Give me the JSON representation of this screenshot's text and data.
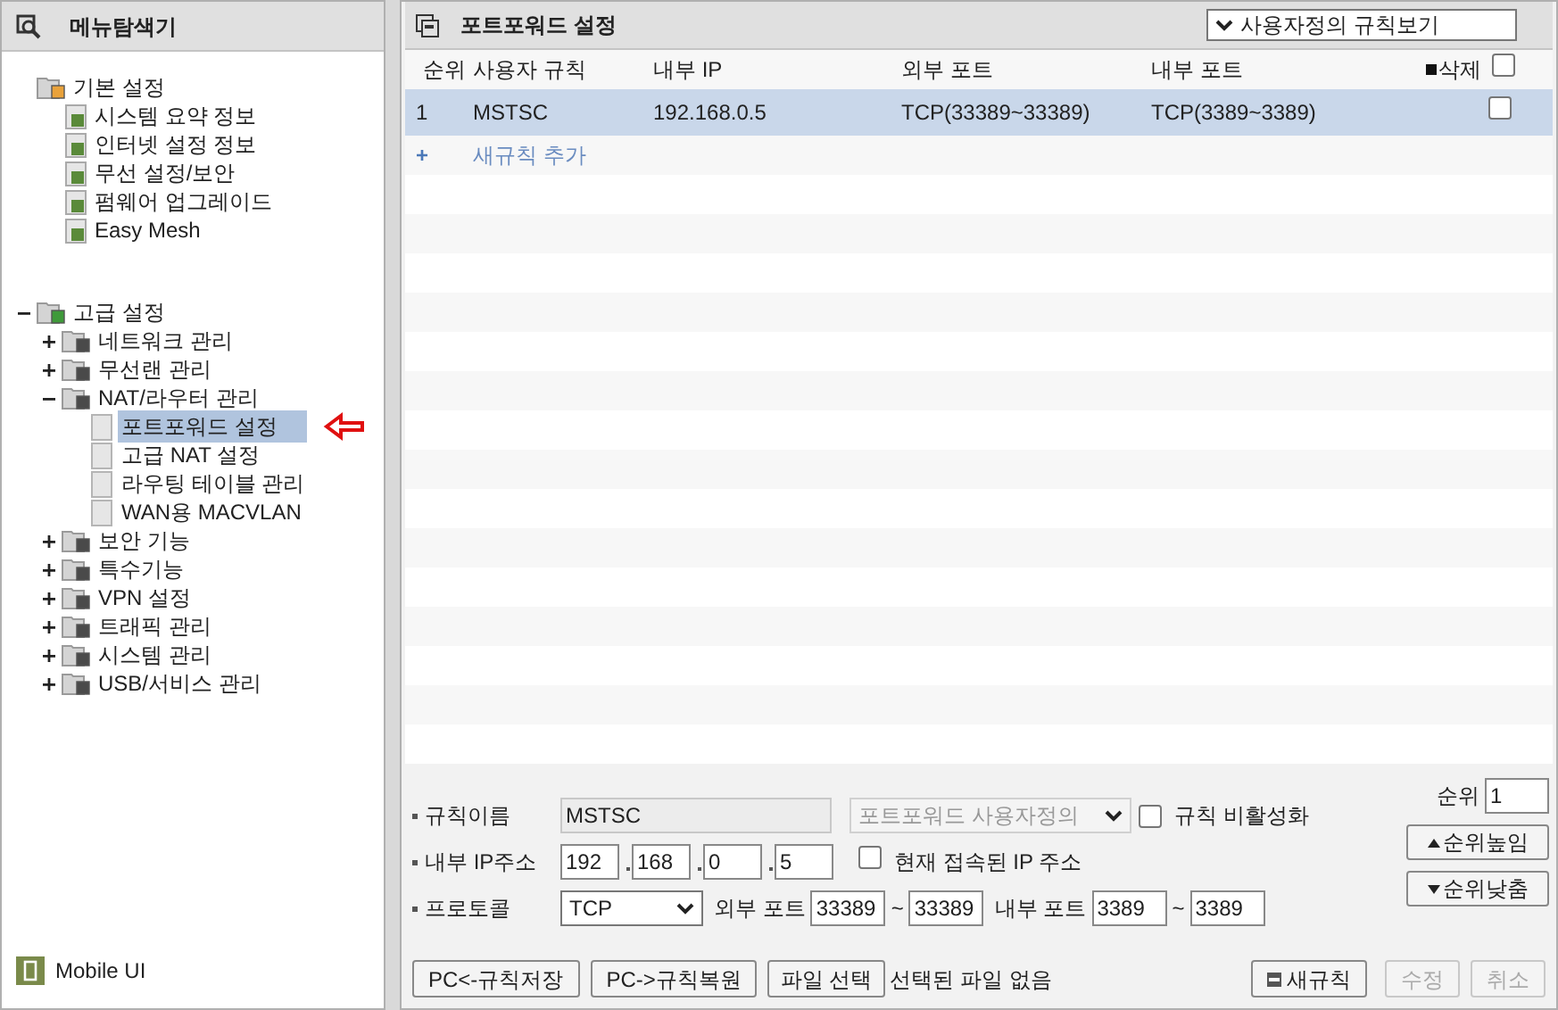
{
  "sidebar": {
    "title": "메뉴탐색기",
    "groups": [
      {
        "label": "기본 설정",
        "children": [
          {
            "label": "시스템 요약 정보",
            "selected": false
          },
          {
            "label": "인터넷 설정 정보",
            "selected": false
          },
          {
            "label": "무선 설정/보안",
            "selected": false
          },
          {
            "label": "펌웨어 업그레이드",
            "selected": false
          },
          {
            "label": "Easy Mesh",
            "selected": false
          }
        ]
      },
      {
        "label": "고급 설정",
        "expanded": true,
        "children": [
          {
            "label": "네트워크 관리",
            "expanded": false,
            "selected": false
          },
          {
            "label": "무선랜 관리",
            "expanded": false,
            "selected": false
          },
          {
            "label": "NAT/라우터 관리",
            "expanded": true,
            "selected": false,
            "children": [
              {
                "label": "포트포워드 설정",
                "selected": true
              },
              {
                "label": "고급 NAT 설정",
                "selected": false
              },
              {
                "label": "라우팅 테이블 관리",
                "selected": false
              },
              {
                "label": "WAN용 MACVLAN",
                "selected": false
              }
            ]
          },
          {
            "label": "보안 기능",
            "expanded": false,
            "selected": false
          },
          {
            "label": "특수기능",
            "expanded": false,
            "selected": false
          },
          {
            "label": "VPN 설정",
            "expanded": false,
            "selected": false
          },
          {
            "label": "트래픽 관리",
            "expanded": false,
            "selected": false
          },
          {
            "label": "시스템 관리",
            "expanded": false,
            "selected": false
          },
          {
            "label": "USB/서비스 관리",
            "expanded": false,
            "selected": false
          }
        ]
      }
    ],
    "footer": "Mobile UI"
  },
  "panel": {
    "title": "포트포워드 설정",
    "view_select": "사용자정의 규칙보기",
    "table": {
      "columns": [
        "순위",
        "사용자 규칙",
        "내부 IP",
        "외부 포트",
        "내부 포트",
        "삭제"
      ],
      "select_all_checked": false,
      "rows": [
        {
          "cells": [
            "1",
            "MSTSC",
            "192.168.0.5",
            "TCP(33389~33389)",
            "TCP(3389~3389)"
          ],
          "selected": true,
          "checked": false
        }
      ],
      "add_row": {
        "icon": "+",
        "label": "새규칙 추가"
      }
    },
    "form": {
      "rule_name": {
        "label": "규칙이름",
        "value": "MSTSC"
      },
      "template": {
        "value": "포트포워드 사용자정의",
        "disabled": true
      },
      "disable_rule": {
        "label": "규칙 비활성화",
        "checked": false
      },
      "ip": {
        "label": "내부 IP주소",
        "octets": [
          "192",
          "168",
          "0",
          "5"
        ]
      },
      "current_ip": {
        "label": "현재 접속된 IP 주소",
        "checked": false
      },
      "protocol": {
        "label": "프로토콜",
        "value": "TCP"
      },
      "ext_port": {
        "label": "외부 포트",
        "from": "33389",
        "sep": "~",
        "to": "33389"
      },
      "int_port": {
        "label": "내부 포트",
        "from": "3389",
        "sep": "~",
        "to": "3389"
      },
      "order": {
        "label": "순위",
        "value": "1"
      },
      "order_buttons": [
        {
          "label": "순위높임",
          "kind": "up"
        },
        {
          "label": "순위낮춤",
          "kind": "down"
        }
      ]
    },
    "bottom": {
      "left_buttons": [
        "PC<-규칙저장",
        "PC->규칙복원"
      ],
      "file_button": "파일 선택",
      "file_status": "선택된 파일 없음",
      "right_buttons": [
        {
          "label": "새규칙",
          "kind": "add",
          "disabled": false
        },
        {
          "label": "수정",
          "kind": "plain",
          "disabled": true
        },
        {
          "label": "취소",
          "kind": "plain",
          "disabled": true
        }
      ]
    }
  }
}
